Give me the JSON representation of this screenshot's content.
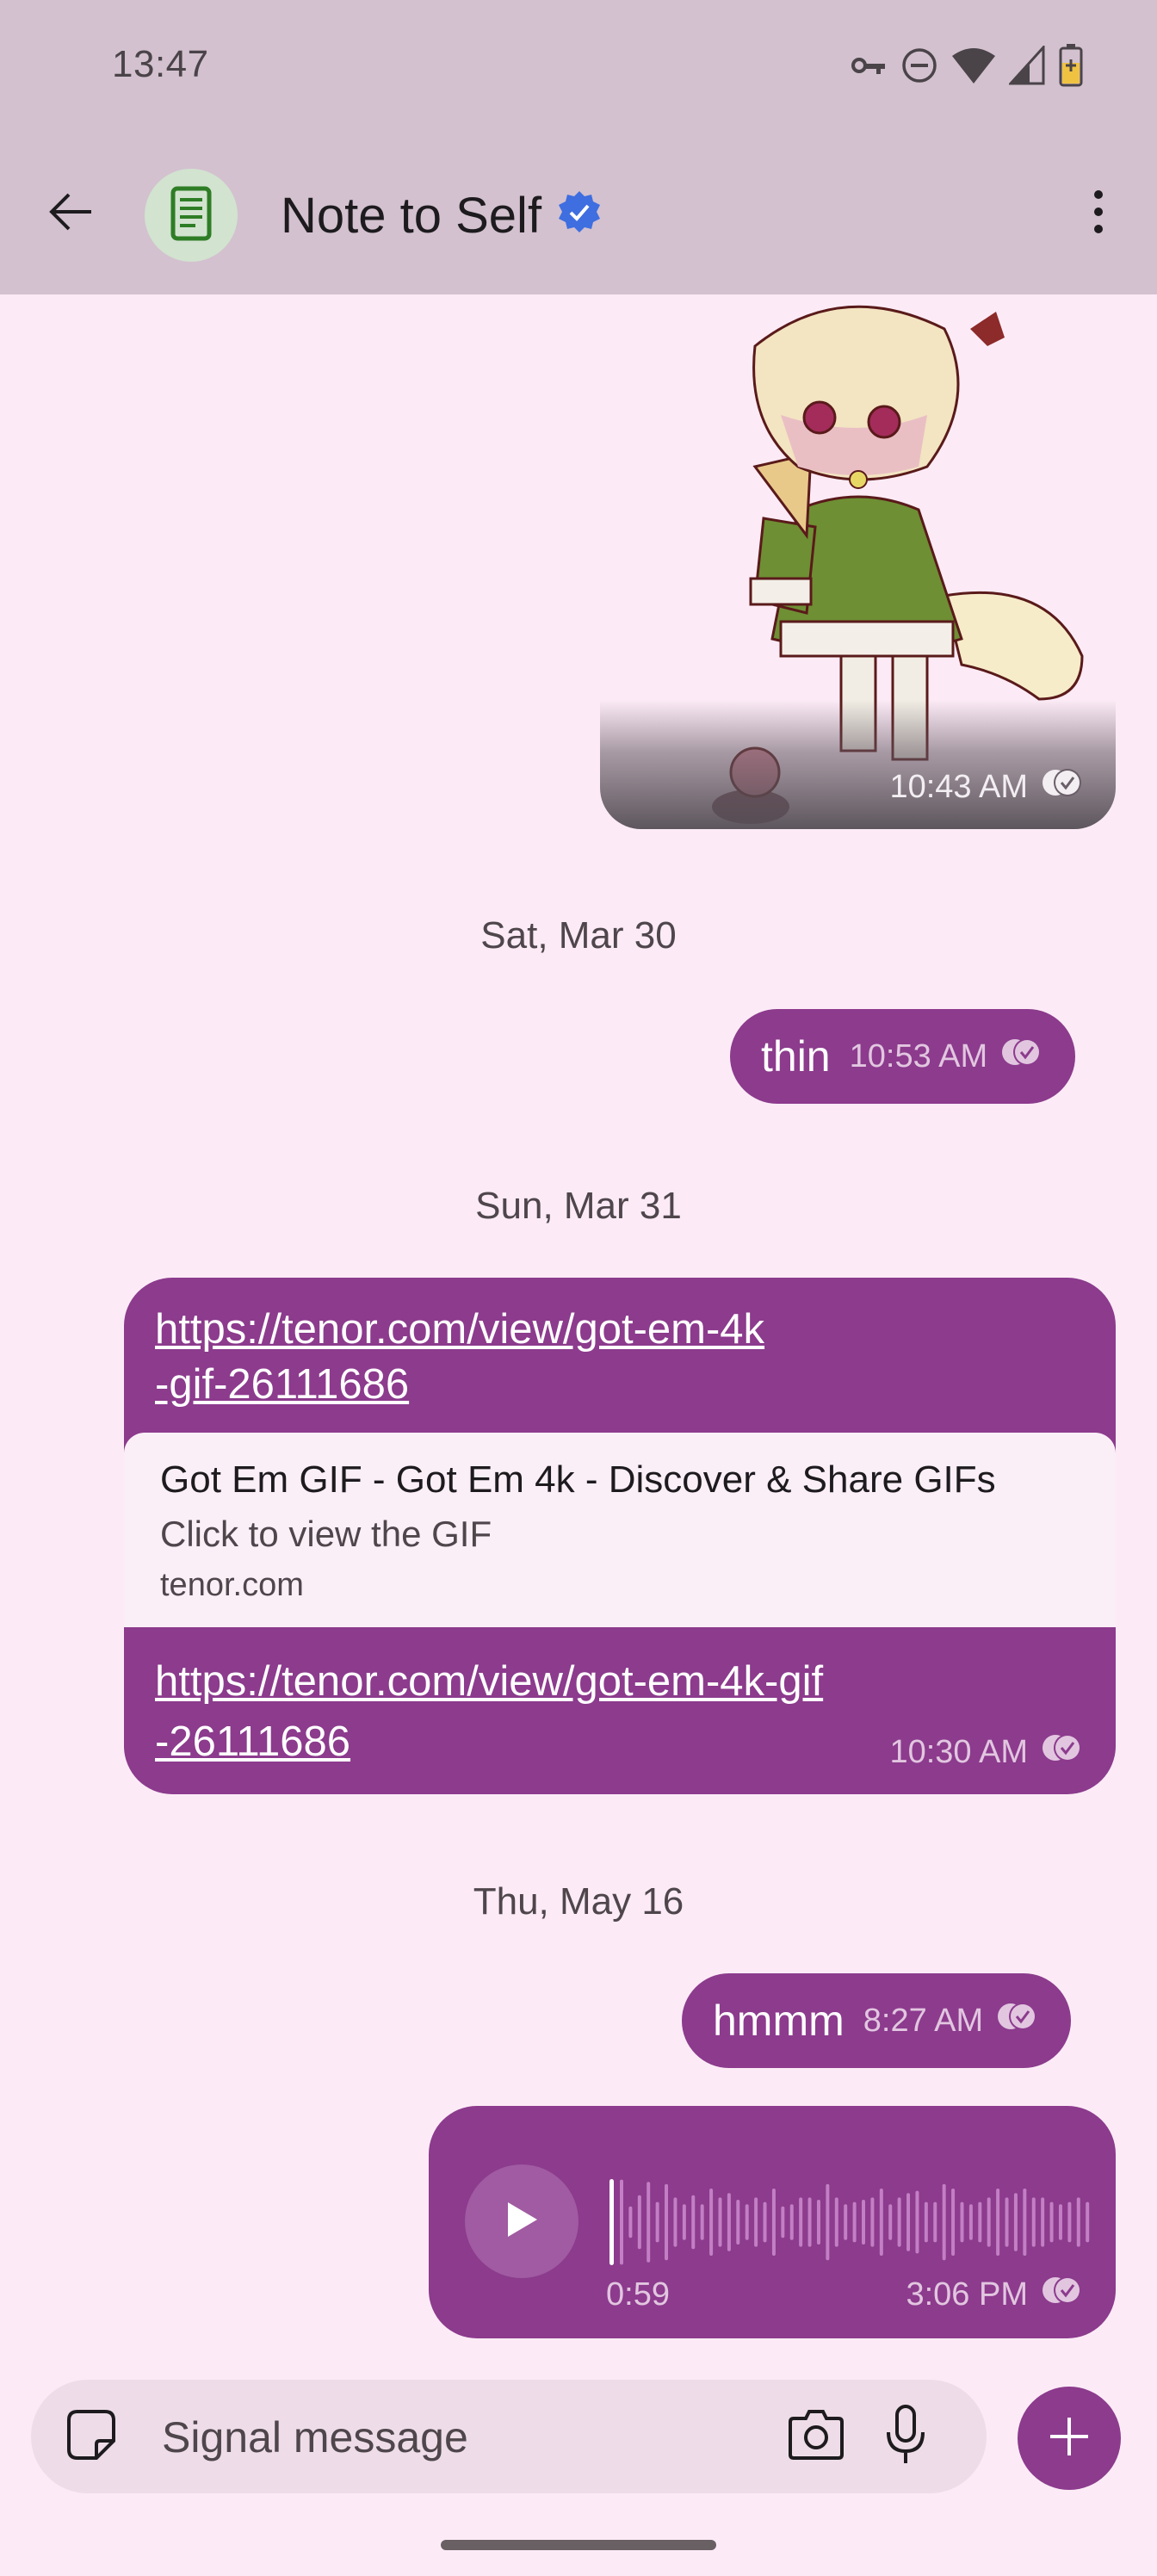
{
  "status_bar": {
    "time": "13:47",
    "icons": [
      "vpn-key-icon",
      "do-not-disturb-icon",
      "wifi-icon",
      "cell-signal-icon",
      "battery-charging-icon"
    ]
  },
  "header": {
    "back_icon": "arrow-left-icon",
    "avatar_icon": "note-document-icon",
    "title": "Note to Self",
    "verified_icon": "verified-badge-icon",
    "menu_icon": "more-vertical-icon"
  },
  "colors": {
    "header_bg": "#d3c1cf",
    "chat_bg": "#fcebf6",
    "bubble": "#8c3b8d",
    "meta_text": "#e2c6e0",
    "verified_blue": "#3e6ee0",
    "avatar_bg": "#d2e3d0",
    "avatar_fg": "#2e7d25"
  },
  "messages": [
    {
      "type": "image",
      "description": "anime fox-eared girl with dropped ice cream cone",
      "time": "10:43 AM",
      "status_icon": "delivered-check-icon"
    },
    {
      "type": "date",
      "label": "Sat, Mar 30"
    },
    {
      "type": "text",
      "text": "thin",
      "time": "10:53 AM",
      "status_icon": "delivered-check-icon"
    },
    {
      "type": "date",
      "label": "Sun, Mar 31"
    },
    {
      "type": "link",
      "link_top": "https://tenor.com/view/got-em-4k-gif-26111686",
      "link_top_lines": [
        "https://tenor.com/view/got-em-4k",
        "-gif-26111686"
      ],
      "preview": {
        "title": "Got Em GIF - Got Em 4k - Discover & Share GIFs",
        "description": "Click to view the GIF",
        "domain": "tenor.com"
      },
      "link_bottom_lines": [
        "https://tenor.com/view/got-em-4k-gif",
        "-26111686"
      ],
      "time": "10:30 AM",
      "status_icon": "delivered-check-icon"
    },
    {
      "type": "date",
      "label": "Thu, May 16"
    },
    {
      "type": "text",
      "text": "hmmm",
      "time": "8:27 AM",
      "status_icon": "delivered-check-icon"
    },
    {
      "type": "voice",
      "duration": "0:59",
      "playback_progress": 0,
      "time": "3:06 PM",
      "status_icon": "delivered-check-icon",
      "waveform_levels": [
        0.95,
        0.35,
        0.6,
        0.9,
        0.45,
        0.85,
        0.55,
        0.4,
        0.6,
        0.4,
        0.75,
        0.55,
        0.65,
        0.5,
        0.4,
        0.55,
        0.45,
        0.75,
        0.35,
        0.4,
        0.55,
        0.55,
        0.5,
        0.85,
        0.55,
        0.4,
        0.45,
        0.5,
        0.55,
        0.75,
        0.4,
        0.55,
        0.65,
        0.7,
        0.45,
        0.45,
        0.85,
        0.75,
        0.45,
        0.4,
        0.45,
        0.55,
        0.75,
        0.55,
        0.65,
        0.75,
        0.55,
        0.55,
        0.45,
        0.4,
        0.45,
        0.55,
        0.45
      ]
    }
  ],
  "composer": {
    "placeholder": "Signal message",
    "sticker_icon": "sticker-icon",
    "camera_icon": "camera-icon",
    "mic_icon": "microphone-icon",
    "attach_icon": "plus-icon"
  }
}
